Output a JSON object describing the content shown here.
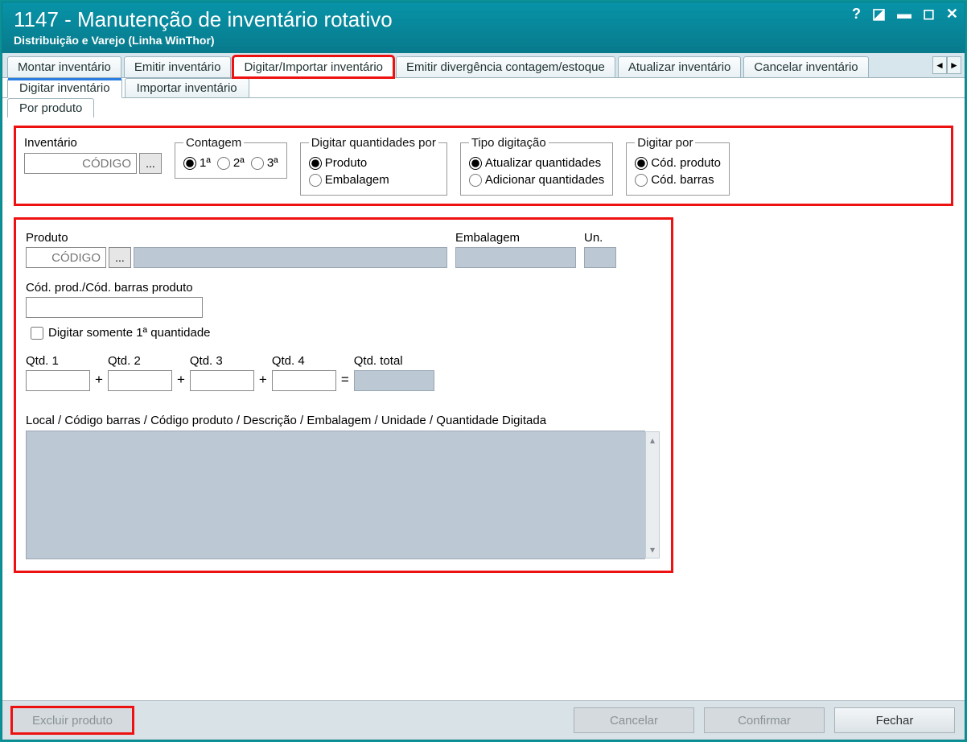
{
  "titlebar": {
    "title": "1147 - Manutenção de inventário rotativo",
    "subtitle": "Distribuição e Varejo (Linha WinThor)"
  },
  "tabs_main": [
    {
      "label": "Montar inventário"
    },
    {
      "label": "Emitir inventário"
    },
    {
      "label": "Digitar/Importar inventário",
      "highlighted": true
    },
    {
      "label": "Emitir divergência contagem/estoque"
    },
    {
      "label": "Atualizar inventário"
    },
    {
      "label": "Cancelar inventário"
    }
  ],
  "tabs_sub1": [
    {
      "label": "Digitar inventário",
      "active": true
    },
    {
      "label": "Importar inventário"
    }
  ],
  "tabs_sub2": [
    {
      "label": "Por produto",
      "active": true
    }
  ],
  "inventario": {
    "label": "Inventário",
    "placeholder": "CÓDIGO"
  },
  "contagem": {
    "legend": "Contagem",
    "options": [
      "1ª",
      "2ª",
      "3ª"
    ],
    "selected": "1ª"
  },
  "digitar_qtd_por": {
    "legend": "Digitar quantidades por",
    "options": [
      "Produto",
      "Embalagem"
    ],
    "selected": "Produto"
  },
  "tipo_digitacao": {
    "legend": "Tipo digitação",
    "options": [
      "Atualizar quantidades",
      "Adicionar quantidades"
    ],
    "selected": "Atualizar quantidades"
  },
  "digitar_por": {
    "legend": "Digitar por",
    "options": [
      "Cód. produto",
      "Cód. barras"
    ],
    "selected": "Cód. produto"
  },
  "produto": {
    "label": "Produto",
    "placeholder": "CÓDIGO",
    "embalagem_label": "Embalagem",
    "un_label": "Un."
  },
  "cod_prod_barras": {
    "label": "Cód. prod./Cód. barras produto"
  },
  "chk_primeira_qtd": {
    "label": "Digitar somente 1ª quantidade",
    "checked": false
  },
  "qtds": {
    "q1": "Qtd. 1",
    "q2": "Qtd. 2",
    "q3": "Qtd. 3",
    "q4": "Qtd. 4",
    "total": "Qtd. total"
  },
  "list_label": "Local / Código barras / Código produto / Descrição / Embalagem / Unidade / Quantidade Digitada",
  "buttons": {
    "excluir": "Excluir produto",
    "cancelar": "Cancelar",
    "confirmar": "Confirmar",
    "fechar": "Fechar"
  }
}
